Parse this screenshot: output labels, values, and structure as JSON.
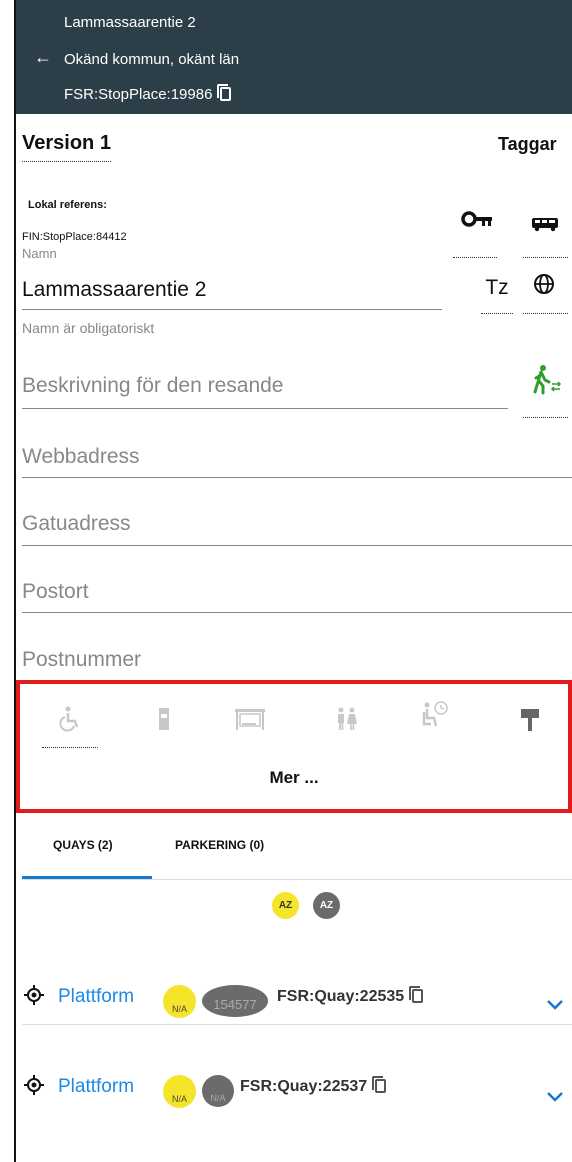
{
  "header": {
    "title": "Lammassaarentie 2",
    "location": "Okänd kommun, okänt län",
    "stop_id": "FSR:StopPlace:19986"
  },
  "version_label": "Version 1",
  "taggar_label": "Taggar",
  "lokal_referens": {
    "label": "Lokal referens:",
    "value": "FIN:StopPlace:84412"
  },
  "name_field": {
    "label": "Namn",
    "value": "Lammassaarentie 2",
    "helper": "Namn är obligatoriskt",
    "tz_label": "Tz"
  },
  "fields": {
    "description_placeholder": "Beskrivning för den resande",
    "url_placeholder": "Webbadress",
    "street_placeholder": "Gatuadress",
    "city_placeholder": "Postort",
    "zip_placeholder": "Postnummer"
  },
  "facilities": {
    "icons": [
      "wheelchair-icon",
      "ticket-machine-icon",
      "shelter-icon",
      "toilet-icon",
      "waiting-room-icon",
      "sign-icon"
    ],
    "more_label": "Mer ..."
  },
  "tabs": [
    {
      "label": "QUAYS (2)",
      "active": true
    },
    {
      "label": "PARKERING (0)",
      "active": false
    }
  ],
  "sort": {
    "a_label": "AZ",
    "b_label": "AZ"
  },
  "quays": [
    {
      "name": "Plattform",
      "badge1": "N/A",
      "badge2": "154577",
      "quay_id": "FSR:Quay:22535"
    },
    {
      "name": "Plattform",
      "badge1": "N/A",
      "badge2": "N/A",
      "quay_id": "FSR:Quay:22537"
    }
  ],
  "colors": {
    "header_bg": "#2c3e47",
    "accent_blue": "#1976d2",
    "link_blue": "#1e88e5",
    "highlight_red": "#e01c1c",
    "badge_yellow": "#f5e52a",
    "walk_green": "#2e9e2e"
  }
}
